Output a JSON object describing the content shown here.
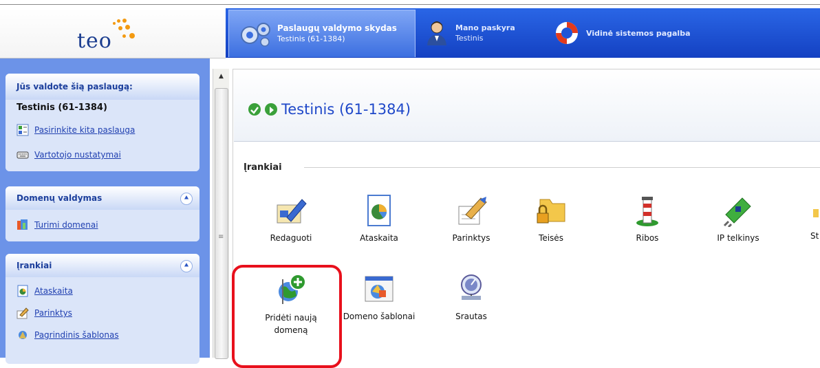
{
  "logo": {
    "text": "teo"
  },
  "nav": {
    "tabs": [
      {
        "title": "Paslaugų valdymo skydas",
        "subtitle": "Testinis (61-1384)",
        "icon": "gears-icon"
      },
      {
        "title": "Mano paskyra",
        "subtitle": "Testinis",
        "icon": "user-icon"
      },
      {
        "title": "Vidinė sistemos pagalba",
        "subtitle": "",
        "icon": "lifebuoy-icon"
      }
    ]
  },
  "sidebar": {
    "service_panel": {
      "header": "Jūs valdote šią paslaugą:",
      "service_name": "Testinis (61-1384)",
      "links": [
        "Pasirinkite kita paslauga",
        "Vartotojo nustatymai"
      ]
    },
    "domains_panel": {
      "header": "Domenų valdymas",
      "links": [
        "Turimi domenai"
      ]
    },
    "tools_panel": {
      "header": "Įrankiai",
      "links": [
        "Ataskaita",
        "Parinktys",
        "Pagrindinis šablonas"
      ]
    }
  },
  "main": {
    "title": "Testinis (61-1384)",
    "section": "Įrankiai",
    "tools_row1": [
      "Redaguoti",
      "Ataskaita",
      "Parinktys",
      "Teisės",
      "Ribos",
      "IP telkinys",
      "St"
    ],
    "tools_row2": [
      "Pridėti naują domeną",
      "Domeno šablonai",
      "Srautas"
    ]
  },
  "colors": {
    "nav_blue": "#1f55d8",
    "sidebar_blue": "#6c93e8",
    "highlight_red": "#e8101c",
    "link_blue": "#1f3fb0"
  }
}
